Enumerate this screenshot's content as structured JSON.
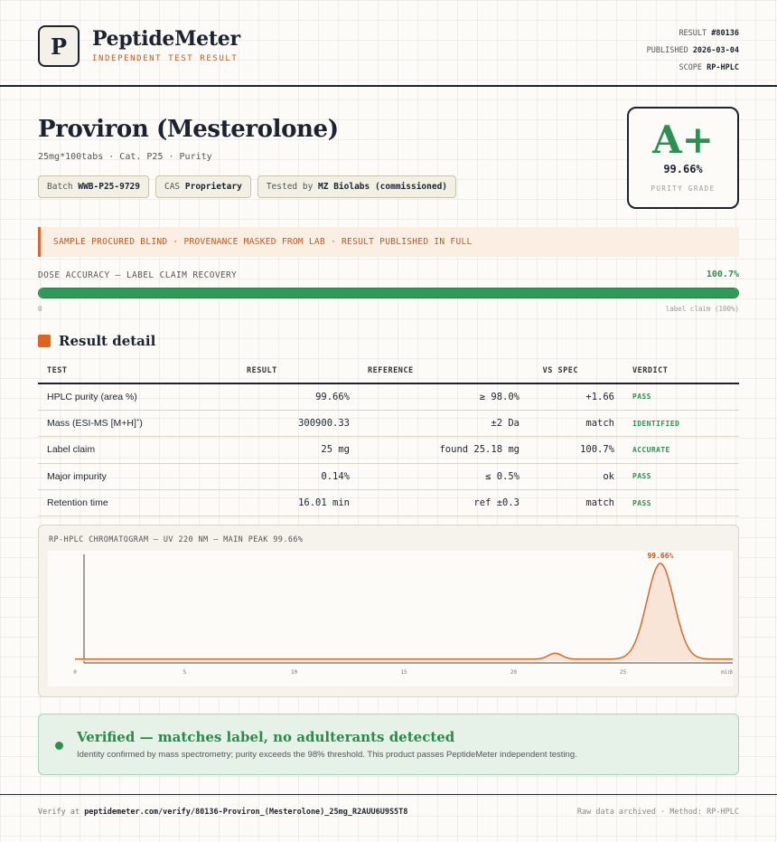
{
  "header": {
    "logo_letter": "P",
    "brand": "PeptideMeter",
    "tagline": "INDEPENDENT TEST RESULT",
    "meta": [
      {
        "label": "RESULT",
        "value": "#80136"
      },
      {
        "label": "PUBLISHED",
        "value": "2026-03-04"
      },
      {
        "label": "SCOPE",
        "value": "RP-HPLC"
      }
    ]
  },
  "product": {
    "title": "Proviron (Mesterolone)",
    "subtitle": "25mg*100tabs · Cat. P25 · Purity",
    "chips": [
      {
        "label": "Batch",
        "value": "WWB-P25-9729"
      },
      {
        "label": "CAS",
        "value": "Proprietary"
      },
      {
        "label": "Tested by",
        "value": "MZ Biolabs (commissioned)"
      }
    ]
  },
  "grade": {
    "letter": "A+",
    "percent": "99.66%",
    "label": "PURITY GRADE",
    "color": "#2a9250"
  },
  "notice": "SAMPLE PROCURED BLIND · PROVENANCE MASKED FROM LAB · RESULT PUBLISHED IN FULL",
  "dose": {
    "label": "DOSE ACCURACY — LABEL CLAIM RECOVERY",
    "value_text": "100.7%",
    "fill_percent": 100,
    "min_label": "0",
    "max_label": "label claim (100%)"
  },
  "results": {
    "section_title": "Result detail",
    "headers": [
      "TEST",
      "RESULT",
      "REFERENCE",
      "VS SPEC",
      "VERDICT"
    ],
    "rows": [
      {
        "test": "HPLC purity (area %)",
        "result": "99.66%",
        "reference": "≥ 98.0%",
        "vs_spec": "+1.66",
        "verdict": "PASS"
      },
      {
        "test": "Mass (ESI-MS [M+H]",
        "test_sup": "+",
        "test_end": ")",
        "result": "300900.33",
        "reference": "±2 Da",
        "vs_spec": "match",
        "verdict": "IDENTIFIED"
      },
      {
        "test": "Label claim",
        "result": "25 mg",
        "reference": "found 25.18 mg",
        "vs_spec": "100.7%",
        "verdict": "ACCURATE"
      },
      {
        "test": "Major impurity",
        "result": "0.14%",
        "reference": "≤ 0.5%",
        "vs_spec": "ok",
        "verdict": "PASS"
      },
      {
        "test": "Retention time",
        "result": "16.01 min",
        "reference": "ref ±0.3",
        "vs_spec": "match",
        "verdict": "PASS"
      }
    ]
  },
  "chart_data": {
    "type": "line",
    "title": "RP-HPLC CHROMATOGRAM — UV 220 NM — MAIN PEAK 99.66%",
    "xlim": [
      0,
      30
    ],
    "x_ticks": [
      "0",
      "5",
      "10",
      "15",
      "20",
      "25",
      "30"
    ],
    "x_end_label": "min",
    "baseline": 0.02,
    "peaks": [
      {
        "center": 21.9,
        "height": 0.06,
        "width": 0.32
      },
      {
        "center": 26.7,
        "height": 0.98,
        "width": 0.62,
        "label": "99.66%"
      }
    ],
    "line_color": "#d9692a",
    "fill_color": "#f7e0cf"
  },
  "verified": {
    "title": "Verified — matches label, no adulterants detected",
    "subtitle": "Identity confirmed by mass spectrometry; purity exceeds the 98% threshold. This product passes PeptideMeter independent testing."
  },
  "footer": {
    "verify_prefix": "Verify at",
    "verify_url": "peptidemeter.com/verify/80136-Proviron_(Mesterolone)_25mg_R2AUU6U9S5T8",
    "right": "Raw data archived · Method: RP-HPLC"
  }
}
